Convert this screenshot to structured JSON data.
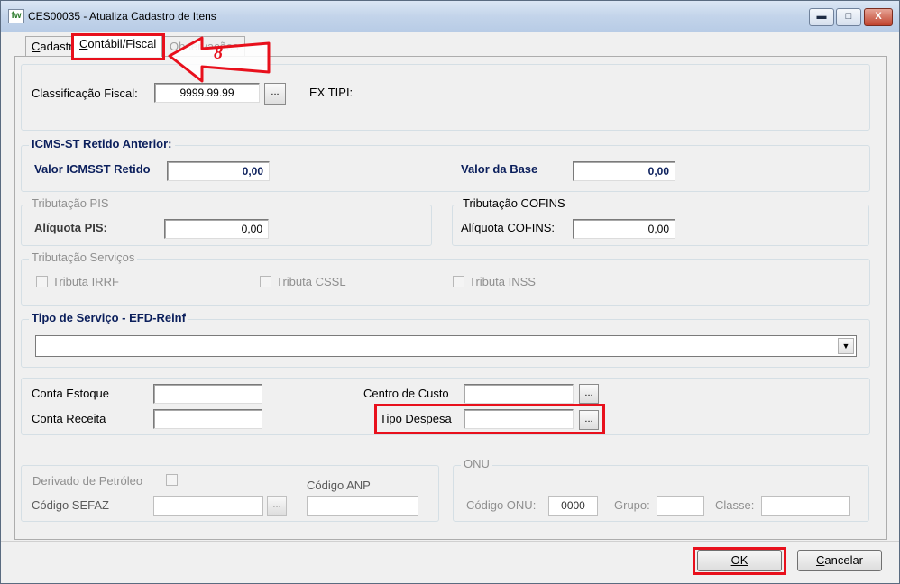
{
  "window": {
    "title": "CES00035 - Atualiza Cadastro de Itens",
    "app_icon": "fw",
    "controls": {
      "minimize": "▬",
      "maximize": "□",
      "close": "X"
    }
  },
  "tabs": [
    {
      "label": "Cadastro",
      "underline": "C",
      "rest": "adastro"
    },
    {
      "label": "Contábil/Fiscal",
      "underline": "C",
      "rest": "ontábil/Fiscal"
    },
    {
      "label": "Observações"
    }
  ],
  "annotation": {
    "step_number": "8"
  },
  "fiscal": {
    "classificacao_label": "Classificação Fiscal:",
    "classificacao_value": "9999.99.99",
    "ex_tipi_label": "EX TIPI:",
    "ellipsis": "..."
  },
  "icms": {
    "title": "ICMS-ST Retido Anterior:",
    "valor_label": "Valor ICMSST Retido",
    "valor_value": "0,00",
    "base_label": "Valor da Base",
    "base_value": "0,00"
  },
  "pis": {
    "title": "Tributação PIS",
    "aliquota_label": "Alíquota PIS:",
    "aliquota_value": "0,00"
  },
  "cofins": {
    "title": "Tributação COFINS",
    "aliquota_label": "Alíquota COFINS:",
    "aliquota_value": "0,00"
  },
  "servicos": {
    "title": "Tributação Serviços",
    "irrf": "Tributa IRRF",
    "cssl": "Tributa CSSL",
    "inss": "Tributa INSS"
  },
  "reinf": {
    "title": "Tipo de Serviço - EFD-Reinf",
    "selected": "",
    "arrow": "▼"
  },
  "contas": {
    "estoque_label": "Conta  Estoque",
    "receita_label": "Conta Receita",
    "centro_label": "Centro de Custo",
    "despesa_label": "Tipo Despesa",
    "ellipsis": "..."
  },
  "petroleo": {
    "derivado_label": "Derivado de Petróleo",
    "sefaz_label": "Código SEFAZ",
    "anp_label": "Código ANP",
    "ellipsis": "..."
  },
  "onu": {
    "title": "ONU",
    "codigo_label": "Código ONU:",
    "codigo_value": "0000",
    "grupo_label": "Grupo:",
    "classe_label": "Classe:"
  },
  "footer": {
    "ok_label": "OK",
    "cancel_label": "Cancelar",
    "cancel_rest": "ancelar"
  },
  "colors": {
    "highlight_red": "#e8101c",
    "section_navy": "#0b1f5c"
  }
}
